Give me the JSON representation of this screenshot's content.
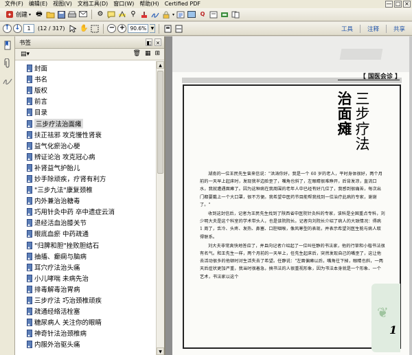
{
  "menu": [
    "文件(F)",
    "编辑(E)",
    "视图(V)",
    "文档工具(D)",
    "窗口(W)",
    "帮助(H)",
    "Certified PDF"
  ],
  "window_controls": [
    "—",
    "□",
    "×"
  ],
  "toolbar1": {
    "create_label": "创建",
    "create_icon": "create-icon"
  },
  "toolbar2": {
    "page_value": "1",
    "page_total": "(12 / 317)",
    "zoom_value": "90.6%",
    "links": [
      "工具",
      "注释",
      "共享"
    ]
  },
  "bookmarks_panel": {
    "title": "书签",
    "items": [
      "封面",
      "书名",
      "版权",
      "前言",
      "目录",
      "三步疗法治面瘫",
      "扶正祛邪  攻克慢性肾衰",
      "益气化瘀治心梗",
      "辨证论治  攻克冠心病",
      "补肾益气护胎儿",
      "妙手除顽疾，疗肾有利方",
      "\"三步九法\"康复颈椎",
      "内外兼治治糖毒",
      "巧用针灸中药  卒中遗症云消",
      "退经活血治膝关节",
      "眼底血瘀  中药疏通",
      "\"归脾和胆\"挫败胆结石",
      "抽搐、癫痫与脑病",
      "耳穴疗法治头痛",
      "小儿哮喘  未病先治",
      "排毒解毒治胃病",
      "三步疗法  巧治颈椎顽疾",
      "疏通经络活栓塞",
      "糖尿病人  关注你的眼睛",
      "神奇针法治颈椎病",
      "内服外治驱头痛"
    ],
    "selected_index": 5
  },
  "document": {
    "section_tag": "【 国医会诊 】",
    "title_bold": [
      "治",
      "面",
      "瘫"
    ],
    "title_light": [
      "三",
      "步",
      "疗",
      "法"
    ],
    "paragraphs": [
      "湖南的一位王民先生曾来信说：\"洪涛你好，我是一个 60 岁的老人，平时身体很好，两个月前的一天早上起床时，发现我半边脸歪了，嘴角也斜了，左眼睛很难睁开，后背发凉，直流口水，我就遭遇面瘫了。因为这种病在我周围的老年人中已经有好几位了，我感到很痛苦，每次出门都要戴上一个大口罩，很不方便。我希望中医药节目能帮我找到一位治疗此病的专家，谢谢了。\"",
      "收到这封信后，记者为王民先生找到了陕西省中医院针灸科的专家，该科是全国重点专科，刘少明大夫是这个科室的学术带头人，也是该院院长。记者向刘院长介绍了病人的大致情况：得病 1 周了，舌冷、头疼、发热、鼻塞、口腔咽喉，像风寒型的表现，并表示希望刘医生能与病人取得联系。",
      "刘大夫非常爽快地答应了，并且向记者介绍起了一位叫任静的书法家，他的行草和小楷书法很有名气。和王先生一样，两个月前的一天早上，任先生起床后，突然发现自己的嘴歪了，这让他去活动很多的他顿时对生活失去了希望。任静说：\"左面偏瘫以后，嘴角往下掉，眼睛也斜，一两天后症状更加严重，我当时很着急，搞书法的人很重视形象，因为书法本身就是一个形象、一个艺术，书法家以这个"
    ],
    "page_number": "1"
  },
  "colors": {
    "accent": "#2255aa",
    "bookmark_icon": "#5d7fb8"
  }
}
